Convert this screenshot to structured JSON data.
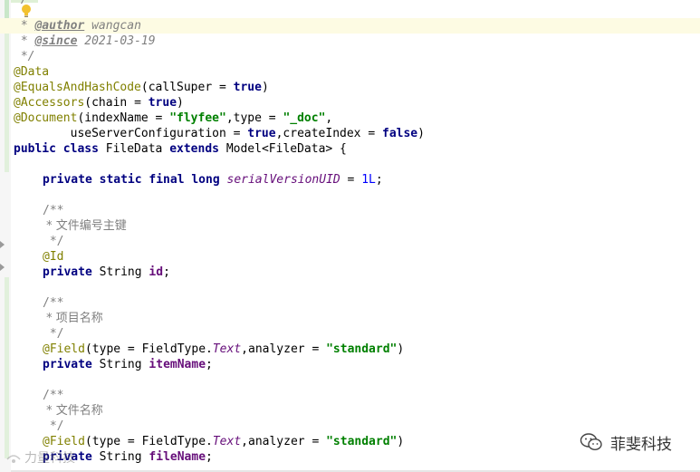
{
  "editor": {
    "lines": {
      "l0": "*/",
      "author_tag": "@author",
      "author_name": " wangcan",
      "since_tag": "@since",
      "since_date": " 2021-03-19",
      "comment_end": " */",
      "ann_data": "@Data",
      "ann_equals": "@EqualsAndHashCode",
      "equals_args_pre": "(callSuper = ",
      "equals_true": "true",
      "equals_args_post": ")",
      "ann_accessors": "@Accessors",
      "accessors_pre": "(chain = ",
      "accessors_true": "true",
      "accessors_post": ")",
      "ann_document": "@Document",
      "doc_pre": "(indexName = ",
      "doc_index": "\"flyfee\"",
      "doc_mid": ",type = ",
      "doc_type": "\"_doc\"",
      "doc_post": ",",
      "doc2_pre": "        useServerConfiguration = ",
      "doc2_true": "true",
      "doc2_mid": ",createIndex = ",
      "doc2_false": "false",
      "doc2_post": ")",
      "cls_public": "public class",
      "cls_name": " FileData ",
      "cls_extends": "extends",
      "cls_rest": " Model<FileData> {",
      "ser_mods": "private static final long",
      "ser_name": "serialVersionUID",
      "ser_eq": " = ",
      "ser_val": "1L",
      "ser_semi": ";",
      "jd_open": "/**",
      "jd1_text": " * 文件编号主键",
      "jd_close": " */",
      "ann_id": "@Id",
      "priv": "private",
      "f1_type": " String ",
      "f1_name": "id",
      "semi": ";",
      "jd2_text": " * 项目名称",
      "ann_field": "@Field",
      "field_pre": "(type = FieldType.",
      "field_text": "Text",
      "field_mid": ",analyzer = ",
      "field_str": "\"standard\"",
      "field_post": ")",
      "f2_name": "itemName",
      "jd3_text": " * 文件名称",
      "f3_name": "fileName"
    }
  },
  "watermarks": {
    "left_text": "力量科技",
    "right_text": "菲斐科技"
  },
  "colors": {
    "keyword": "#000080",
    "annotation": "#808000",
    "comment": "#808080",
    "string": "#008000",
    "field": "#660e7a",
    "number": "#0000ff",
    "current_line": "#fdfbe3"
  },
  "icons": {
    "intention": "lightbulb-icon",
    "wechat": "wechat-icon"
  }
}
